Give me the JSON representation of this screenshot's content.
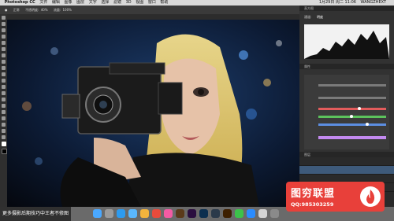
{
  "menubar": {
    "apple": "",
    "app_name": "Photoshop CC",
    "menus": [
      "文件",
      "编辑",
      "图像",
      "图层",
      "文字",
      "选择",
      "滤镜",
      "3D",
      "视图",
      "窗口",
      "帮助"
    ],
    "clock": "1月29日 周二 11:06",
    "user": "WANGZHEXT"
  },
  "options_bar": {
    "mode_label": "正常",
    "opacity_label": "不透明度:",
    "opacity_value": "40%",
    "flow_label": "流量:",
    "flow_value": "100%"
  },
  "right_panel": {
    "histogram_tab": "直方图",
    "channel_label": "通道:",
    "channel_value": "明度",
    "properties_tab": "属性",
    "layers_tab": "图层"
  },
  "caption": {
    "text": "更多摄影后期技巧中王者不修图"
  },
  "watermark": {
    "title": "图穷联盟",
    "qq": "QQ:985303259"
  },
  "colors": {
    "brand_red": "#e8403a",
    "panel_bg": "#323232"
  }
}
